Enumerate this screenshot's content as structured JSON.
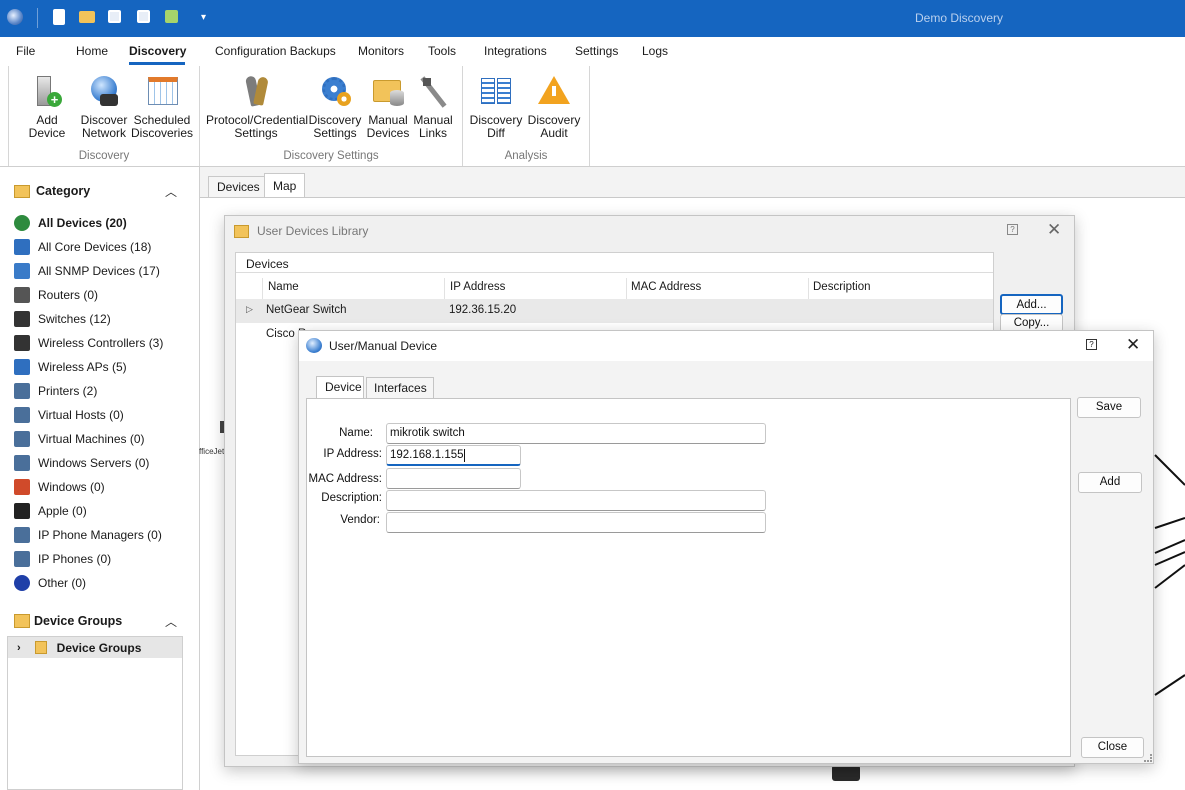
{
  "app": {
    "title": "Demo Discovery"
  },
  "menu": [
    "File",
    "Home",
    "Discovery",
    "Configuration Backups",
    "Monitors",
    "Tools",
    "Integrations",
    "Settings",
    "Logs"
  ],
  "ribbon": {
    "discovery_group": {
      "caption": "Discovery",
      "buttons": [
        [
          "Add Device",
          ""
        ],
        [
          "Discover",
          "Network"
        ],
        [
          "Scheduled",
          "Discoveries"
        ]
      ]
    },
    "settings_group": {
      "caption": "Discovery Settings",
      "buttons": [
        [
          "Protocol/Credential",
          "Settings"
        ],
        [
          "Discovery",
          "Settings"
        ],
        [
          "Manual",
          "Devices"
        ],
        [
          "Manual",
          "Links"
        ]
      ]
    },
    "analysis_group": {
      "caption": "Analysis",
      "buttons": [
        [
          "Discovery",
          "Diff"
        ],
        [
          "Discovery",
          "Audit"
        ]
      ]
    }
  },
  "category": {
    "title": "Category",
    "items": [
      {
        "label": "All Devices (20)",
        "icon": "globe-icon",
        "color": "#2e8b3e"
      },
      {
        "label": "All Core Devices (18)",
        "icon": "network-icon",
        "color": "#2f6fbf"
      },
      {
        "label": "All SNMP Devices (17)",
        "icon": "snmp-icon",
        "color": "#3a7bc8"
      },
      {
        "label": "Routers (0)",
        "icon": "router-icon",
        "color": "#555"
      },
      {
        "label": "Switches (12)",
        "icon": "switch-icon",
        "color": "#333"
      },
      {
        "label": "Wireless Controllers (3)",
        "icon": "wireless-controller-icon",
        "color": "#333"
      },
      {
        "label": "Wireless APs (5)",
        "icon": "wireless-ap-icon",
        "color": "#2f6fbf"
      },
      {
        "label": "Printers (2)",
        "icon": "printer-icon",
        "color": "#4a6f9a"
      },
      {
        "label": "Virtual Hosts (0)",
        "icon": "server-icon",
        "color": "#4a6f9a"
      },
      {
        "label": "Virtual Machines (0)",
        "icon": "vm-icon",
        "color": "#4a6f9a"
      },
      {
        "label": "Windows Servers (0)",
        "icon": "windows-server-icon",
        "color": "#4a6f9a"
      },
      {
        "label": "Windows (0)",
        "icon": "windows-icon",
        "color": "#d04a2a"
      },
      {
        "label": "Apple (0)",
        "icon": "apple-icon",
        "color": "#222"
      },
      {
        "label": "IP Phone Managers (0)",
        "icon": "phone-manager-icon",
        "color": "#4a6f9a"
      },
      {
        "label": "IP Phones (0)",
        "icon": "ip-phone-icon",
        "color": "#4a6f9a"
      },
      {
        "label": "Other (0)",
        "icon": "question-icon",
        "color": "#1f3fa8"
      }
    ]
  },
  "device_groups": {
    "title": "Device Groups",
    "item": "Device Groups"
  },
  "tabs": [
    "Devices",
    "Map"
  ],
  "library": {
    "title": "User Devices Library",
    "section": "Devices",
    "columns": [
      "Name",
      "IP Address",
      "MAC Address",
      "Description"
    ],
    "rows": [
      {
        "name": "NetGear Switch",
        "ip": "192.36.15.20",
        "mac": "",
        "desc": ""
      },
      {
        "name": "Cisco R",
        "ip": "",
        "mac": "",
        "desc": ""
      }
    ],
    "buttons": {
      "add": "Add...",
      "copy": "Copy..."
    }
  },
  "manual": {
    "title": "User/Manual Device",
    "tabs": [
      "Device",
      "Interfaces"
    ],
    "labels": {
      "name": "Name:",
      "ip": "IP Address:",
      "mac": "MAC Address:",
      "description": "Description:",
      "vendor": "Vendor:"
    },
    "values": {
      "name": "mikrotik switch",
      "ip": "192.168.1.155",
      "mac": "",
      "description": "",
      "vendor": ""
    },
    "buttons": {
      "save": "Save",
      "add": "Add",
      "close": "Close"
    }
  },
  "map_label": "fficeJet",
  "colors": {
    "titlebar": "#1565c0",
    "accent": "#1565c0"
  }
}
